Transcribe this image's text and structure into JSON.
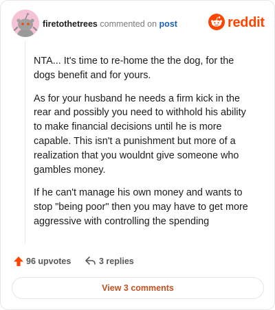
{
  "header": {
    "username": "firetothetrees",
    "action": "commented on",
    "post_link": "post",
    "brand": "reddit"
  },
  "comment": {
    "paragraphs": [
      "NTA... It's time to re-home the the dog, for the dogs benefit and for yours.",
      "As for your husband he needs a firm kick in the rear and possibly you need to withhold his ability to make financial decisions until he is more capable. This isn't a punishment but more of a realization that you wouldnt give someone who gambles money.",
      "If he can't manage his own money and wants to stop \"being poor\" then you may have to get more aggressive with controlling the spending"
    ]
  },
  "actions": {
    "upvotes_label": "96 upvotes",
    "replies_label": "3 replies",
    "view_comments_label": "View 3 comments"
  },
  "colors": {
    "brand": "#ff4500",
    "link": "#1a5fb4",
    "view_button_text": "#c35020",
    "avatar_bg": "#f6c2d6"
  },
  "icons": {
    "avatar": "snoo-avatar-icon",
    "logo": "reddit-logo-icon",
    "upvote": "upvote-arrow-icon",
    "reply": "reply-arrow-icon"
  }
}
